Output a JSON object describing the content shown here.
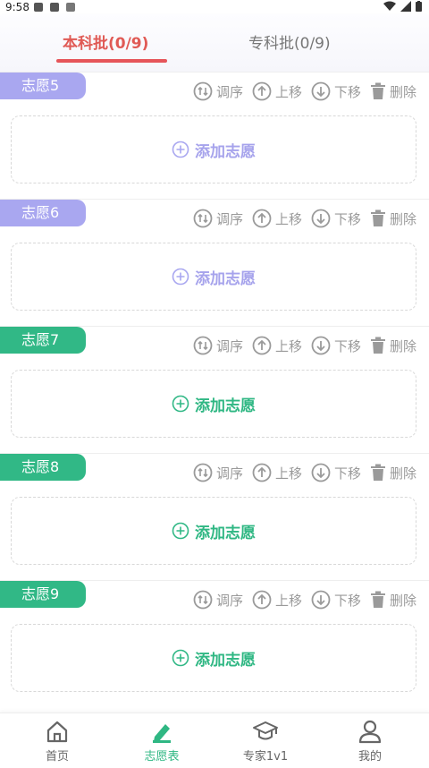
{
  "status_bar": {
    "time": "9:58"
  },
  "tabs": [
    {
      "label": "本科批(0/9)",
      "active": true
    },
    {
      "label": "专科批(0/9)",
      "active": false
    }
  ],
  "actions": {
    "reorder": "调序",
    "move_up": "上移",
    "move_down": "下移",
    "delete": "删除"
  },
  "add_label": "添加志愿",
  "cards": [
    {
      "title": "志愿5",
      "theme": "purple"
    },
    {
      "title": "志愿6",
      "theme": "purple"
    },
    {
      "title": "志愿7",
      "theme": "green"
    },
    {
      "title": "志愿8",
      "theme": "green"
    },
    {
      "title": "志愿9",
      "theme": "green"
    }
  ],
  "colors": {
    "accent_red": "#e6555a",
    "purple": "#a9a7f0",
    "green": "#31b886"
  },
  "bottom_nav": [
    {
      "label": "首页",
      "icon": "home-icon",
      "active": false
    },
    {
      "label": "志愿表",
      "icon": "edit-icon",
      "active": true
    },
    {
      "label": "专家1v1",
      "icon": "graduation-cap-icon",
      "active": false
    },
    {
      "label": "我的",
      "icon": "user-icon",
      "active": false
    }
  ]
}
